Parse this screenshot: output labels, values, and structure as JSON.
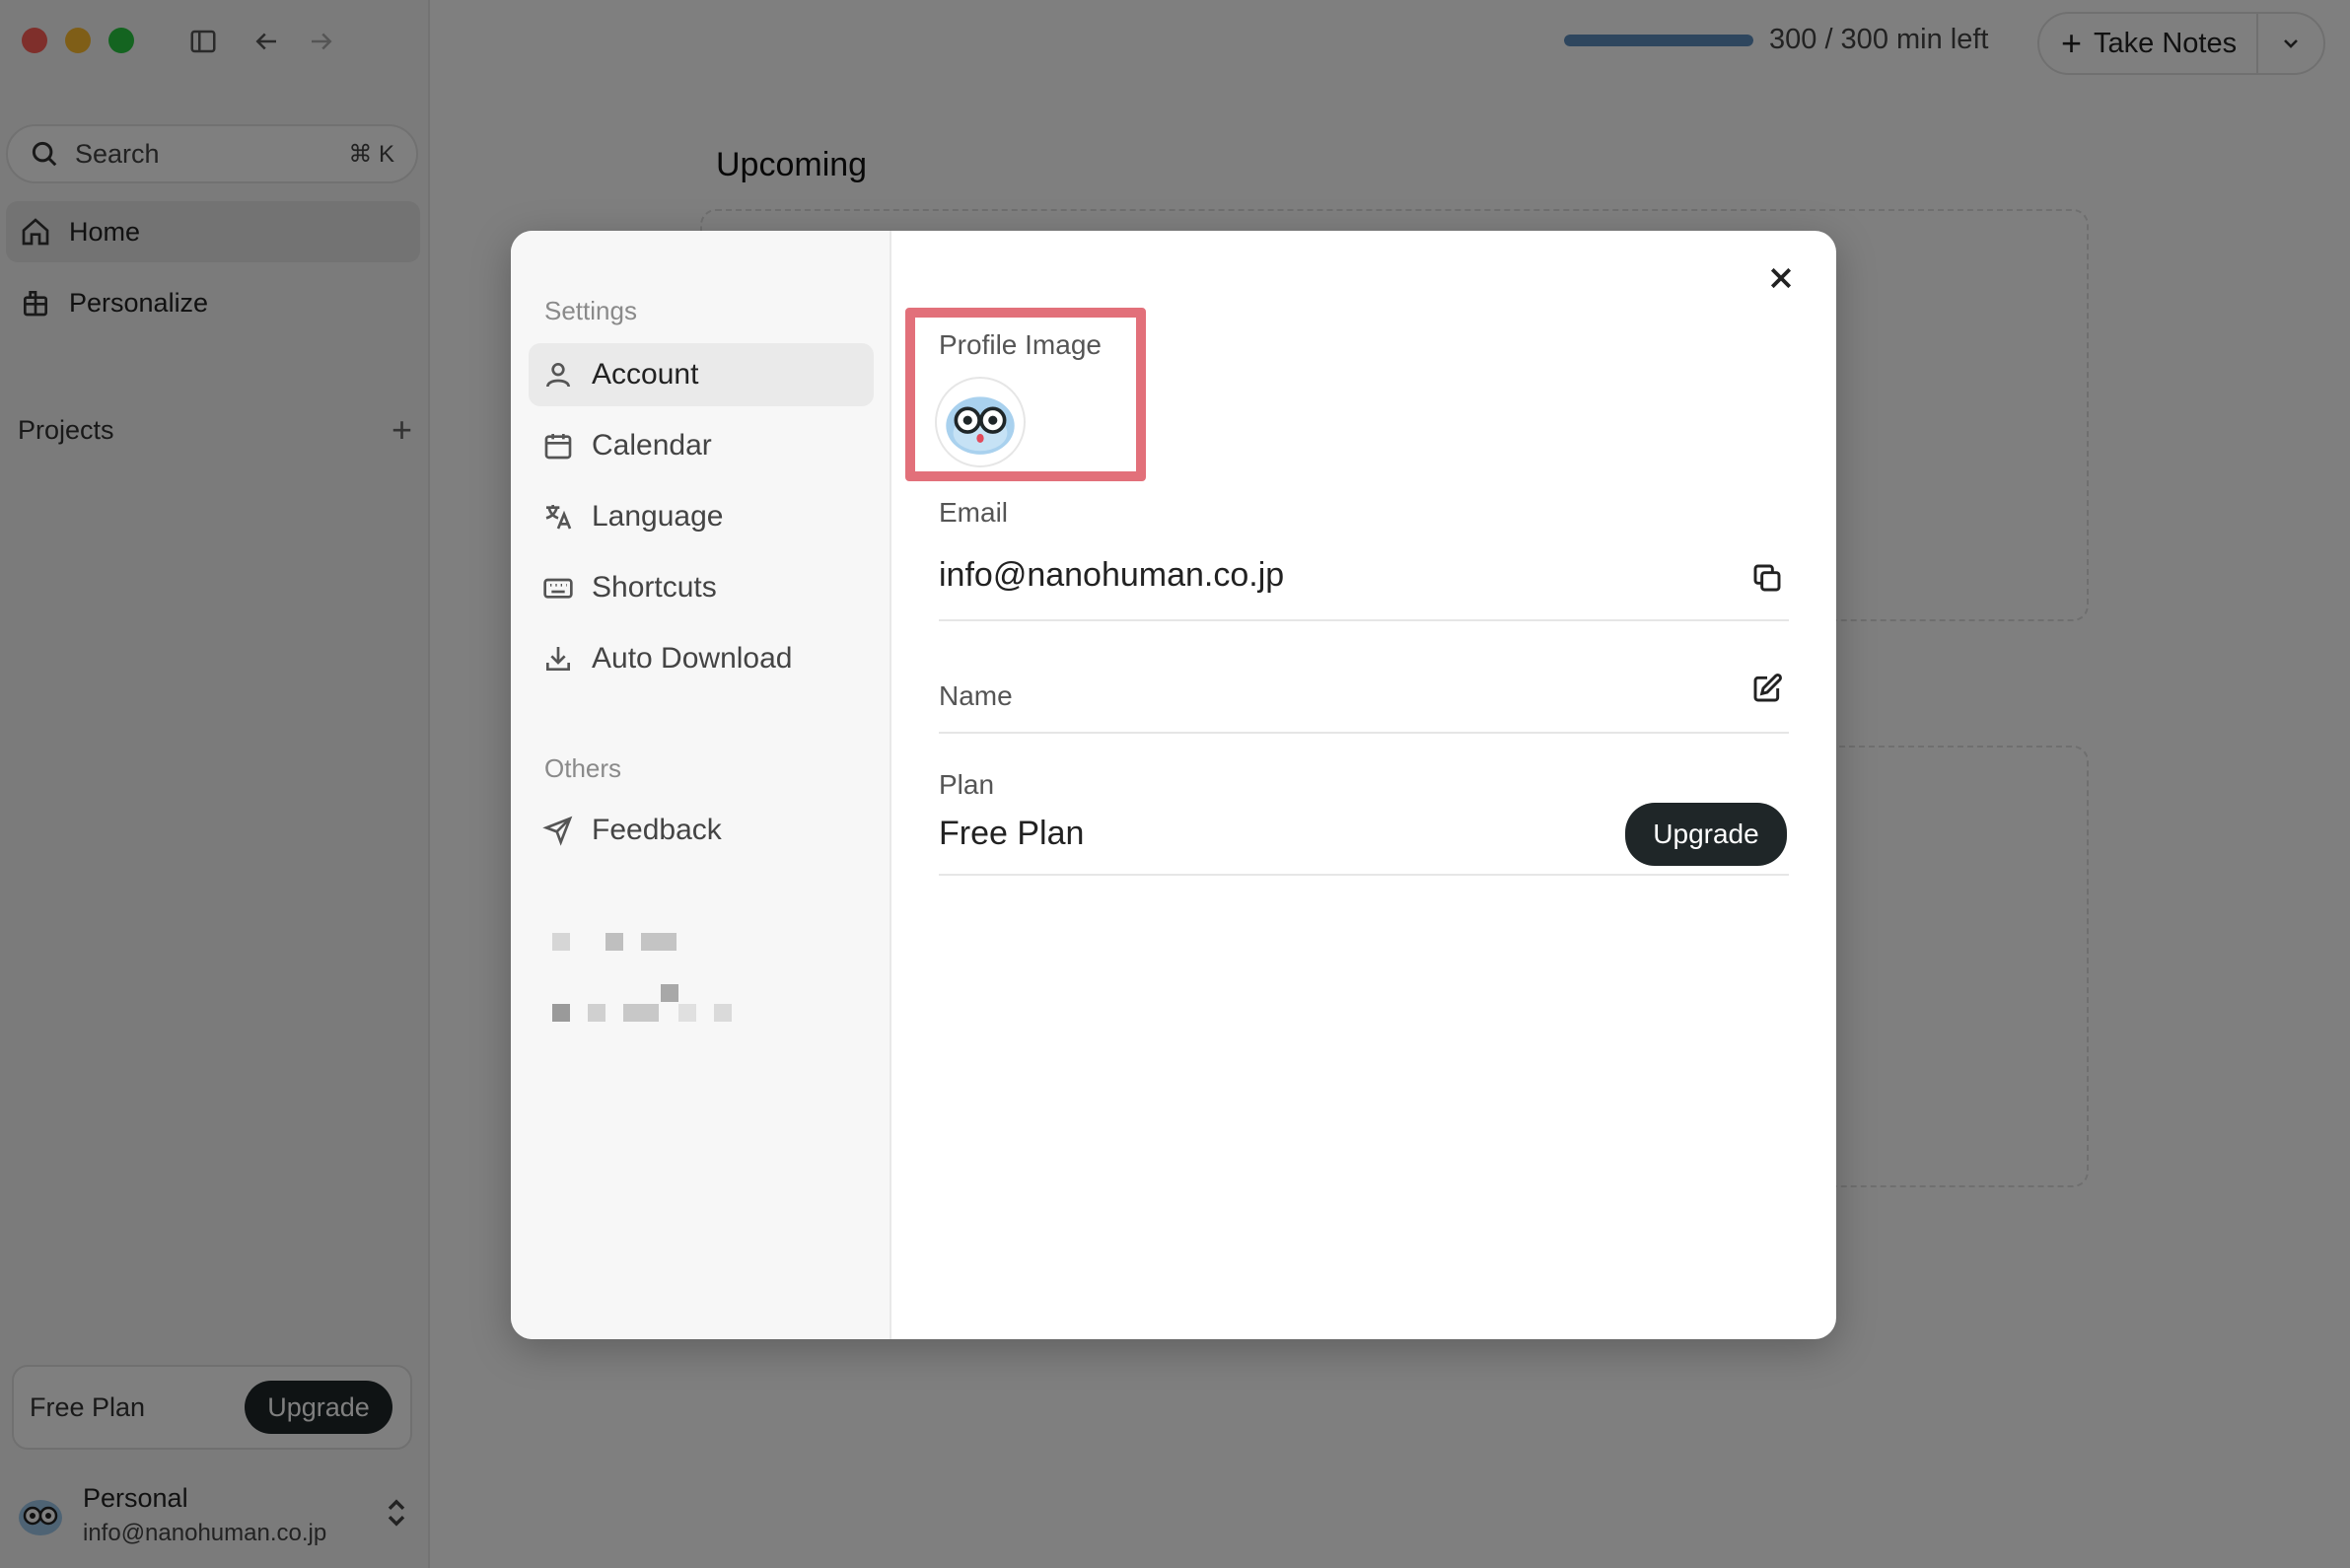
{
  "sidebar": {
    "search": {
      "label": "Search",
      "shortcut": "⌘ K"
    },
    "nav": [
      {
        "label": "Home",
        "icon": "home-icon",
        "active": true
      },
      {
        "label": "Personalize",
        "icon": "personalize-icon",
        "active": false
      }
    ],
    "projects_label": "Projects",
    "plan": {
      "name": "Free Plan",
      "upgrade": "Upgrade"
    },
    "account": {
      "name": "Personal",
      "email": "info@nanohuman.co.jp"
    }
  },
  "topbar": {
    "minutes_text": "300 / 300 min left",
    "minutes_remaining_fraction": 1.0,
    "take_notes": "Take Notes"
  },
  "main": {
    "upcoming_title": "Upcoming"
  },
  "settings": {
    "section_settings": "Settings",
    "items": [
      {
        "label": "Account",
        "icon": "user-icon",
        "active": true
      },
      {
        "label": "Calendar",
        "icon": "calendar-icon",
        "active": false
      },
      {
        "label": "Language",
        "icon": "translate-icon",
        "active": false
      },
      {
        "label": "Shortcuts",
        "icon": "keyboard-icon",
        "active": false
      },
      {
        "label": "Auto Download",
        "icon": "download-icon",
        "active": false
      }
    ],
    "section_others": "Others",
    "others": [
      {
        "label": "Feedback",
        "icon": "send-icon"
      }
    ]
  },
  "account_panel": {
    "profile_image_label": "Profile Image",
    "email_label": "Email",
    "email_value": "info@nanohuman.co.jp",
    "name_label": "Name",
    "plan_label": "Plan",
    "plan_value": "Free Plan",
    "upgrade_label": "Upgrade"
  },
  "colors": {
    "highlight": "#e2707a",
    "button_dark": "#1f2628",
    "progress": "#5c8cbd"
  }
}
